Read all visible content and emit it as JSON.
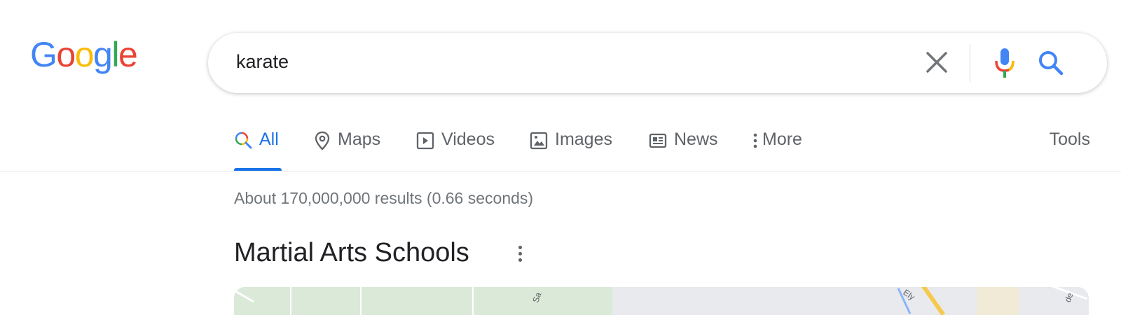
{
  "logo": {
    "letters": [
      "G",
      "o",
      "o",
      "g",
      "l",
      "e"
    ]
  },
  "search": {
    "query": "karate"
  },
  "tabs": [
    {
      "label": "All",
      "icon": "search-multicolor-icon",
      "active": true
    },
    {
      "label": "Maps",
      "icon": "map-pin-icon"
    },
    {
      "label": "Videos",
      "icon": "play-box-icon"
    },
    {
      "label": "Images",
      "icon": "image-icon"
    },
    {
      "label": "News",
      "icon": "newspaper-icon"
    },
    {
      "label": "More",
      "icon": "vertical-dots-icon"
    }
  ],
  "tools_label": "Tools",
  "result_stats": "About 170,000,000 results (0.66 seconds)",
  "section": {
    "title": "Martial Arts Schools"
  },
  "map": {
    "labels": [
      "Sa",
      "Ely",
      "de"
    ]
  },
  "colors": {
    "blue": "#4285F4",
    "red": "#EA4335",
    "yellow": "#FBBC05",
    "green": "#34A853",
    "accent": "#1A73E8"
  }
}
